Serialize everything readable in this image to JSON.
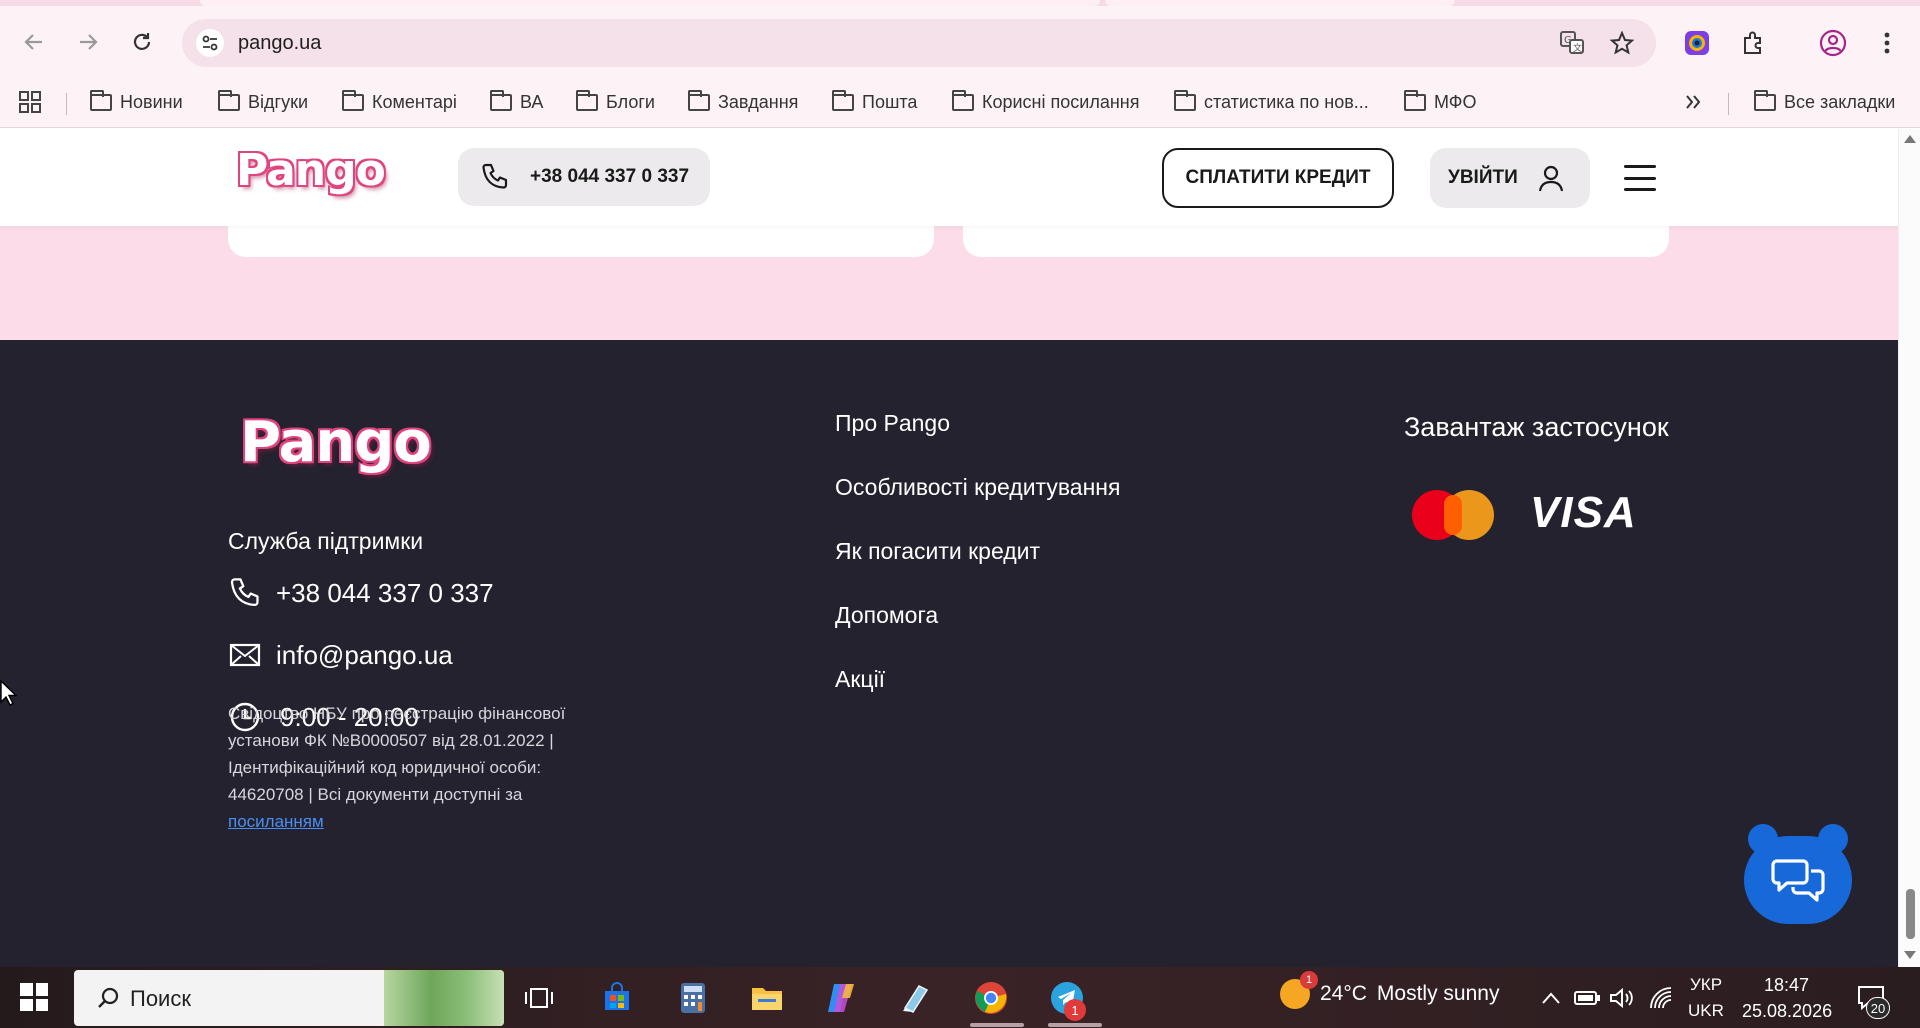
{
  "browser": {
    "url": "pango.ua",
    "bookmarks": [
      {
        "label": "Новини"
      },
      {
        "label": "Відгуки"
      },
      {
        "label": "Коментарі"
      },
      {
        "label": "ВА"
      },
      {
        "label": "Блоги"
      },
      {
        "label": "Завдання"
      },
      {
        "label": "Пошта"
      },
      {
        "label": "Корисні посилання"
      },
      {
        "label": "статистика по нов..."
      },
      {
        "label": "МФО"
      }
    ],
    "all_bookmarks": "Все закладки"
  },
  "header": {
    "logo": "Pango",
    "phone": "+38 044 337 0 337",
    "pay_credit": "СПЛАТИТИ КРЕДИТ",
    "login": "УВІЙТИ"
  },
  "footer": {
    "logo": "Pango",
    "support_title": "Служба підтримки",
    "phone": "+38 044 337 0 337",
    "email": "info@pango.ua",
    "hours": "9:00 - 20:00",
    "legal_text": "Свідоцтво НБУ про реєстрацію фінансової установи ФК №В0000507 від 28.01.2022 | Ідентифікаційний код юридичної особи: 44620708 | Всі документи доступні за ",
    "legal_link": "посиланням",
    "links": [
      {
        "label": "Про Pango"
      },
      {
        "label": "Особливості кредитування"
      },
      {
        "label": "Як погасити кредит"
      },
      {
        "label": "Допомога"
      },
      {
        "label": "Акції"
      }
    ],
    "app_title": "Завантаж застосунок",
    "visa": "VISA"
  },
  "taskbar": {
    "search_placeholder": "Поиск",
    "weather_temp": "24°C",
    "weather_text": "Mostly sunny",
    "weather_badge": "1",
    "telegram_badge": "1",
    "lang_top": "УКР",
    "lang_bottom": "UKR",
    "time": "18:47",
    "date": "25.08.2026",
    "notifications": "20"
  },
  "colors": {
    "page_bg": "#fbdce8",
    "footer_bg": "#24222e",
    "brand_pink": "#e0447f",
    "chat_blue": "#1769d9",
    "link_blue": "#4a8ef0"
  }
}
